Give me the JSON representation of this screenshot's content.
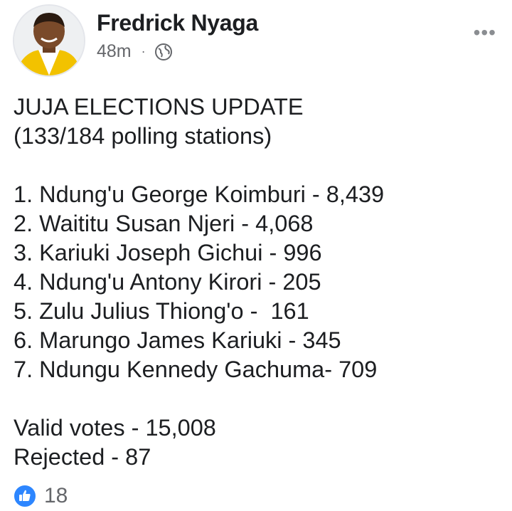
{
  "author": {
    "name": "Fredrick Nyaga",
    "time": "48m",
    "separator": "·",
    "privacy_icon": "globe-icon"
  },
  "post": {
    "title_lines": [
      "JUJA ELECTIONS UPDATE",
      "(133/184 polling stations)"
    ],
    "results": [
      "1. Ndung'u George Koimburi - 8,439",
      "2. Waititu Susan Njeri - 4,068",
      "3. Kariuki Joseph Gichui - 996",
      "4. Ndung'u Antony Kirori - 205",
      "5. Zulu Julius Thiong'o -  161",
      "6. Marungo James Kariuki - 345",
      "7. Ndungu Kennedy Gachuma- 709"
    ],
    "totals": [
      "Valid votes - 15,008",
      "Rejected - 87"
    ]
  },
  "reactions": {
    "icon": "like-icon",
    "count": "18"
  },
  "colors": {
    "like_blue": "#2d86ff",
    "meta_gray": "#65676b",
    "text": "#1c1e21"
  }
}
